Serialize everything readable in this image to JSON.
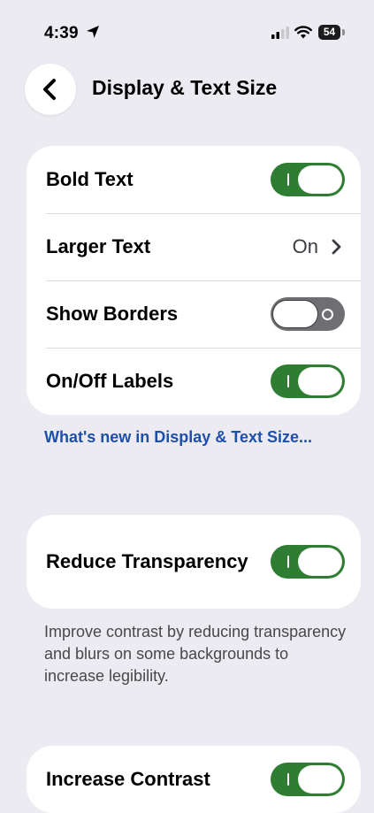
{
  "status_bar": {
    "time": "4:39",
    "battery": "54",
    "icons": [
      "location-arrow-icon",
      "cellular-signal-icon",
      "wifi-icon",
      "battery-icon"
    ]
  },
  "nav": {
    "back_icon": "chevron-left-icon",
    "title": "Display & Text Size"
  },
  "group1": {
    "rows": [
      {
        "label": "Bold Text",
        "toggle": "on"
      },
      {
        "label": "Larger Text",
        "value": "On"
      },
      {
        "label": "Show Borders",
        "toggle": "off"
      },
      {
        "label": "On/Off Labels",
        "toggle": "on"
      }
    ]
  },
  "link": {
    "text": "What's new in Display & Text Size..."
  },
  "group2": {
    "label": "Reduce Transparency",
    "toggle": "on"
  },
  "group2_footer": "Improve contrast by reducing transparency and blurs on some backgrounds to increase legibility.",
  "group3": {
    "label": "Increase Contrast",
    "toggle": "on"
  },
  "colors": {
    "background": "#ebebf1",
    "toggle_on": "#2e7d32",
    "toggle_off": "#6e6e73",
    "link": "#1e4fa8"
  }
}
